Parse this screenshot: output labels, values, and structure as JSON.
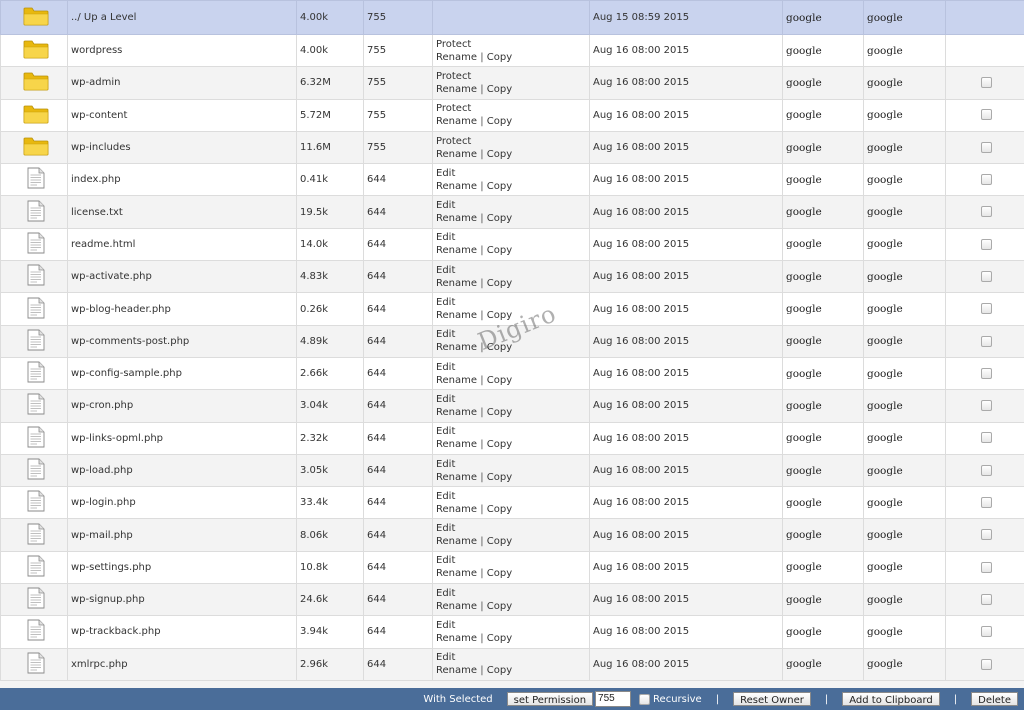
{
  "colors": {
    "header_row": "#c9d3ee",
    "footer_bar": "#4a6d99",
    "folder": "#f0c419"
  },
  "rows": [
    {
      "type": "folder",
      "name": "../ Up a Level",
      "size": "4.00k",
      "perm": "755",
      "action1": "",
      "action2": "",
      "action3": "",
      "date": "Aug 15 08:59 2015",
      "owner": "google",
      "group": "google",
      "checkbox": false,
      "up": true
    },
    {
      "type": "folder",
      "name": "wordpress",
      "size": "4.00k",
      "perm": "755",
      "action1": "Protect",
      "action2": "Rename",
      "action3": "Copy",
      "date": "Aug 16 08:00 2015",
      "owner": "google",
      "group": "google",
      "checkbox": false
    },
    {
      "type": "folder",
      "name": "wp-admin",
      "size": "6.32M",
      "perm": "755",
      "action1": "Protect",
      "action2": "Rename",
      "action3": "Copy",
      "date": "Aug 16 08:00 2015",
      "owner": "google",
      "group": "google",
      "checkbox": true
    },
    {
      "type": "folder",
      "name": "wp-content",
      "size": "5.72M",
      "perm": "755",
      "action1": "Protect",
      "action2": "Rename",
      "action3": "Copy",
      "date": "Aug 16 08:00 2015",
      "owner": "google",
      "group": "google",
      "checkbox": true
    },
    {
      "type": "folder",
      "name": "wp-includes",
      "size": "11.6M",
      "perm": "755",
      "action1": "Protect",
      "action2": "Rename",
      "action3": "Copy",
      "date": "Aug 16 08:00 2015",
      "owner": "google",
      "group": "google",
      "checkbox": true
    },
    {
      "type": "file",
      "name": "index.php",
      "size": "0.41k",
      "perm": "644",
      "action1": "Edit",
      "action2": "Rename",
      "action3": "Copy",
      "date": "Aug 16 08:00 2015",
      "owner": "google",
      "group": "google",
      "checkbox": true
    },
    {
      "type": "file",
      "name": "license.txt",
      "size": "19.5k",
      "perm": "644",
      "action1": "Edit",
      "action2": "Rename",
      "action3": "Copy",
      "date": "Aug 16 08:00 2015",
      "owner": "google",
      "group": "google",
      "checkbox": true
    },
    {
      "type": "file",
      "name": "readme.html",
      "size": "14.0k",
      "perm": "644",
      "action1": "Edit",
      "action2": "Rename",
      "action3": "Copy",
      "date": "Aug 16 08:00 2015",
      "owner": "google",
      "group": "google",
      "checkbox": true
    },
    {
      "type": "file",
      "name": "wp-activate.php",
      "size": "4.83k",
      "perm": "644",
      "action1": "Edit",
      "action2": "Rename",
      "action3": "Copy",
      "date": "Aug 16 08:00 2015",
      "owner": "google",
      "group": "google",
      "checkbox": true
    },
    {
      "type": "file",
      "name": "wp-blog-header.php",
      "size": "0.26k",
      "perm": "644",
      "action1": "Edit",
      "action2": "Rename",
      "action3": "Copy",
      "date": "Aug 16 08:00 2015",
      "owner": "google",
      "group": "google",
      "checkbox": true
    },
    {
      "type": "file",
      "name": "wp-comments-post.php",
      "size": "4.89k",
      "perm": "644",
      "action1": "Edit",
      "action2": "Rename",
      "action3": "Copy",
      "date": "Aug 16 08:00 2015",
      "owner": "google",
      "group": "google",
      "checkbox": true
    },
    {
      "type": "file",
      "name": "wp-config-sample.php",
      "size": "2.66k",
      "perm": "644",
      "action1": "Edit",
      "action2": "Rename",
      "action3": "Copy",
      "date": "Aug 16 08:00 2015",
      "owner": "google",
      "group": "google",
      "checkbox": true
    },
    {
      "type": "file",
      "name": "wp-cron.php",
      "size": "3.04k",
      "perm": "644",
      "action1": "Edit",
      "action2": "Rename",
      "action3": "Copy",
      "date": "Aug 16 08:00 2015",
      "owner": "google",
      "group": "google",
      "checkbox": true
    },
    {
      "type": "file",
      "name": "wp-links-opml.php",
      "size": "2.32k",
      "perm": "644",
      "action1": "Edit",
      "action2": "Rename",
      "action3": "Copy",
      "date": "Aug 16 08:00 2015",
      "owner": "google",
      "group": "google",
      "checkbox": true
    },
    {
      "type": "file",
      "name": "wp-load.php",
      "size": "3.05k",
      "perm": "644",
      "action1": "Edit",
      "action2": "Rename",
      "action3": "Copy",
      "date": "Aug 16 08:00 2015",
      "owner": "google",
      "group": "google",
      "checkbox": true
    },
    {
      "type": "file",
      "name": "wp-login.php",
      "size": "33.4k",
      "perm": "644",
      "action1": "Edit",
      "action2": "Rename",
      "action3": "Copy",
      "date": "Aug 16 08:00 2015",
      "owner": "google",
      "group": "google",
      "checkbox": true
    },
    {
      "type": "file",
      "name": "wp-mail.php",
      "size": "8.06k",
      "perm": "644",
      "action1": "Edit",
      "action2": "Rename",
      "action3": "Copy",
      "date": "Aug 16 08:00 2015",
      "owner": "google",
      "group": "google",
      "checkbox": true
    },
    {
      "type": "file",
      "name": "wp-settings.php",
      "size": "10.8k",
      "perm": "644",
      "action1": "Edit",
      "action2": "Rename",
      "action3": "Copy",
      "date": "Aug 16 08:00 2015",
      "owner": "google",
      "group": "google",
      "checkbox": true
    },
    {
      "type": "file",
      "name": "wp-signup.php",
      "size": "24.6k",
      "perm": "644",
      "action1": "Edit",
      "action2": "Rename",
      "action3": "Copy",
      "date": "Aug 16 08:00 2015",
      "owner": "google",
      "group": "google",
      "checkbox": true
    },
    {
      "type": "file",
      "name": "wp-trackback.php",
      "size": "3.94k",
      "perm": "644",
      "action1": "Edit",
      "action2": "Rename",
      "action3": "Copy",
      "date": "Aug 16 08:00 2015",
      "owner": "google",
      "group": "google",
      "checkbox": true
    },
    {
      "type": "file",
      "name": "xmlrpc.php",
      "size": "2.96k",
      "perm": "644",
      "action1": "Edit",
      "action2": "Rename",
      "action3": "Copy",
      "date": "Aug 16 08:00 2015",
      "owner": "google",
      "group": "google",
      "checkbox": true
    }
  ],
  "footer": {
    "with_selected_label": "With Selected",
    "set_permission_label": "set Permission",
    "permission_value": "755",
    "recursive_label": "Recursive",
    "reset_owner_label": "Reset Owner",
    "add_clipboard_label": "Add to Clipboard",
    "delete_label": "Delete",
    "separator": "|"
  },
  "watermark": "Digiro"
}
